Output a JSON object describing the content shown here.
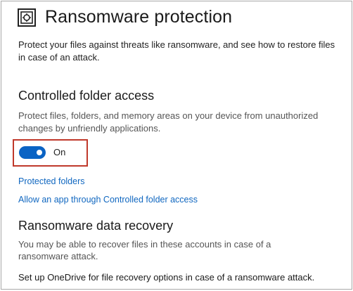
{
  "header": {
    "icon": "ransomware-shield-icon",
    "title": "Ransomware protection"
  },
  "intro": "Protect your files against threats like ransomware, and see how to restore files in case of an attack.",
  "controlled_folder_access": {
    "title": "Controlled folder access",
    "description": "Protect files, folders, and memory areas on your device from unauthorized changes by unfriendly applications.",
    "toggle_state": true,
    "toggle_label": "On",
    "toggle_color": "#0a63c4",
    "highlight_color": "#c0392b"
  },
  "links": {
    "protected_folders": "Protected folders",
    "allow_app": "Allow an app through Controlled folder access"
  },
  "data_recovery": {
    "title": "Ransomware data recovery",
    "description": "You may be able to recover files in these accounts in case of a ransomware attack.",
    "onedrive_text": "Set up OneDrive for file recovery options in case of a ransomware attack."
  }
}
